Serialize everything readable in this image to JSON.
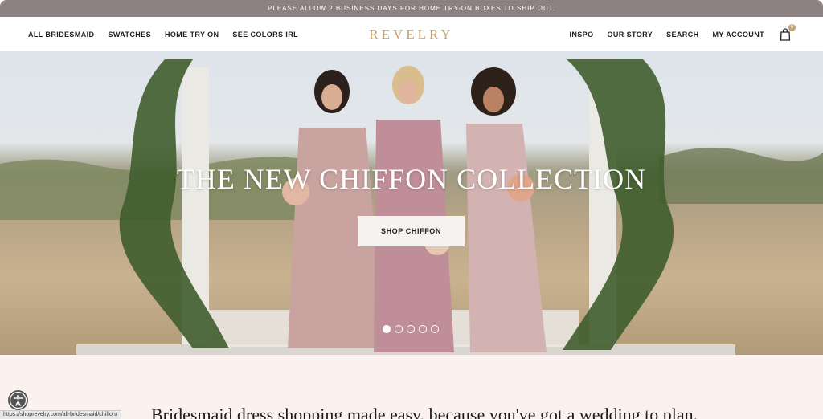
{
  "announcement": "PLEASE ALLOW 2 BUSINESS DAYS FOR HOME TRY-ON BOXES TO SHIP OUT.",
  "nav": {
    "left": [
      "ALL BRIDESMAID",
      "SWATCHES",
      "HOME TRY ON",
      "SEE COLORS IRL"
    ],
    "right": [
      "INSPO",
      "OUR STORY",
      "SEARCH",
      "MY ACCOUNT"
    ]
  },
  "logo": "REVELRY",
  "cart": {
    "count": "0",
    "icon": "shopping-bag-icon"
  },
  "hero": {
    "title": "THE NEW CHIFFON COLLECTION",
    "cta": "SHOP CHIFFON",
    "slides": 5,
    "active_slide": 1
  },
  "tagline": "Bridesmaid dress shopping made easy, because you've got a wedding to plan.",
  "status_url": "https://shoprevelry.com/all-bridesmaid/chiffon/",
  "colors": {
    "announcement_bg": "#8e8181",
    "logo": "#c6a36d",
    "section_bg": "#fbf2f0"
  }
}
